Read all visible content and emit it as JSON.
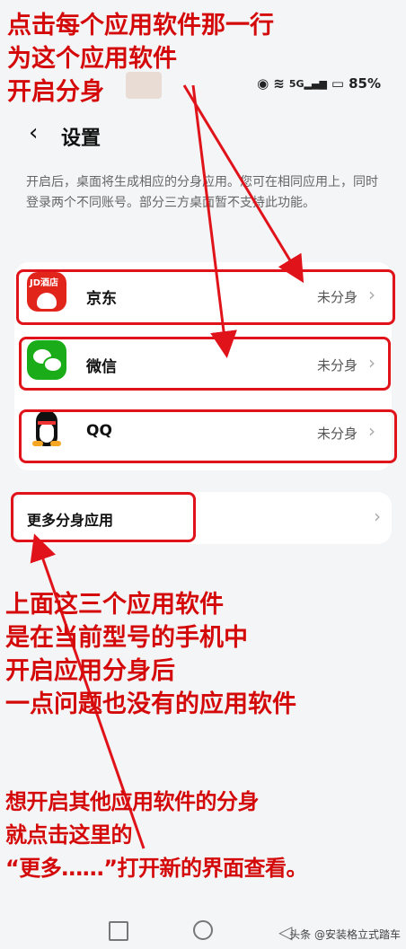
{
  "status": {
    "battery": "85%",
    "network": "5G"
  },
  "header": {
    "back_glyph": "<",
    "title": "设置"
  },
  "description": "开启后，桌面将生成相应的分身应用。您可在相同应用上，同时登录两个不同账号。部分三方桌面暂不支持此功能。",
  "apps": [
    {
      "name": "京东",
      "state": "未分身",
      "icon": "jd-app-icon"
    },
    {
      "name": "微信",
      "state": "未分身",
      "icon": "wechat-app-icon"
    },
    {
      "name": "QQ",
      "state": "未分身",
      "icon": "qq-app-icon"
    }
  ],
  "more": {
    "label": "更多分身应用"
  },
  "annotations": {
    "top": "点击每个应用软件那一行\n为这个应用软件\n开启分身",
    "middle": "上面这三个应用软件\n是在当前型号的手机中\n开启应用分身后\n一点问题也没有的应用软件",
    "bottom": "想开启其他应用软件的分身\n就点击这里的\n“更多……”打开新的界面查看。"
  },
  "jd_icon_text": "JD酒店",
  "watermark": "头条 @安装格立式踏车",
  "colors": {
    "annotation": "#d40a0a",
    "wechat": "#1aad19",
    "jd": "#e1251b"
  }
}
